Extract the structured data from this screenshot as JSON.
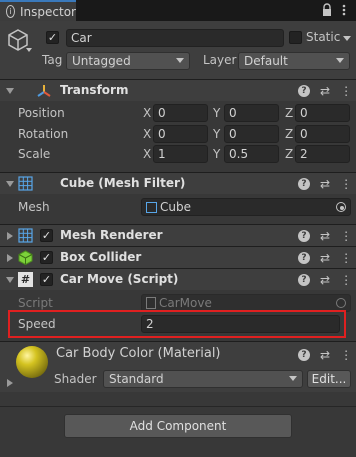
{
  "tab": {
    "title": "Inspector",
    "icon": "info-icon"
  },
  "tab_icons": [
    "lock-icon",
    "kebab-menu-icon"
  ],
  "object": {
    "name": "Car",
    "static_label": "Static",
    "active": true,
    "static_checked": false
  },
  "tag": {
    "label": "Tag",
    "value": "Untagged"
  },
  "layer": {
    "label": "Layer",
    "value": "Default"
  },
  "transform": {
    "title": "Transform",
    "rows": [
      {
        "label": "Position",
        "x": "0",
        "y": "0",
        "z": "0"
      },
      {
        "label": "Rotation",
        "x": "0",
        "y": "0",
        "z": "0"
      },
      {
        "label": "Scale",
        "x": "1",
        "y": "0.5",
        "z": "2"
      }
    ],
    "axes": {
      "x": "X",
      "y": "Y",
      "z": "Z"
    }
  },
  "mesh_filter": {
    "title": "Cube (Mesh Filter)",
    "mesh_label": "Mesh",
    "mesh_value": "Cube"
  },
  "mesh_renderer": {
    "title": "Mesh Renderer"
  },
  "box_collider": {
    "title": "Box Collider"
  },
  "car_move": {
    "title": "Car Move (Script)",
    "script_label": "Script",
    "script_value": "CarMove",
    "speed_label": "Speed",
    "speed_value": "2"
  },
  "material": {
    "title": "Car Body Color (Material)",
    "shader_label": "Shader",
    "shader_value": "Standard",
    "edit_label": "Edit..."
  },
  "add_component": "Add Component",
  "colors": {
    "highlight": "#e02020",
    "accent": "#3a79bb",
    "material_sphere": "#d4c320"
  }
}
